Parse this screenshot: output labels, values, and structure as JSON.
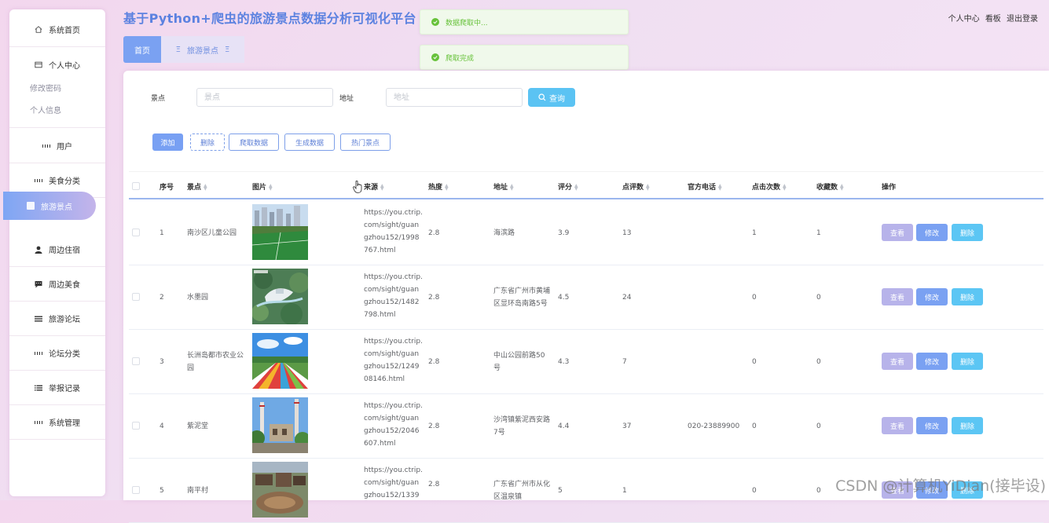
{
  "app": {
    "title": "基于Python+爬虫的旅游景点数据分析可视化平台",
    "top_links": [
      "个人中心",
      "看板",
      "退出登录"
    ]
  },
  "sidebar": {
    "home": "系统首页",
    "personal": "个人中心",
    "personal_sub": [
      "修改密码",
      "个人信息"
    ],
    "items": [
      "用户",
      "美食分类",
      "旅游景点",
      "周边住宿",
      "周边美食",
      "旅游论坛",
      "论坛分类",
      "举报记录",
      "系统管理"
    ],
    "active_index": 2
  },
  "tabs": {
    "home": "首页",
    "scenic": "旅游景点"
  },
  "toasts": [
    "数据爬取中...",
    "爬取完成"
  ],
  "search": {
    "scenic_label": "景点",
    "scenic_placeholder": "景点",
    "address_label": "地址",
    "address_placeholder": "地址",
    "query_label": "查询"
  },
  "actions": {
    "add": "添加",
    "delete": "删除",
    "crawl": "爬取数据",
    "generate": "生成数据",
    "hot": "热门景点"
  },
  "table": {
    "columns": [
      "序号",
      "景点",
      "图片",
      "来源",
      "热度",
      "地址",
      "评分",
      "点评数",
      "官方电话",
      "点击次数",
      "收藏数",
      "操作"
    ],
    "row_actions": {
      "view": "查看",
      "edit": "修改",
      "delete": "删除"
    },
    "rows": [
      {
        "index": "1",
        "name": "南沙区儿童公园",
        "source": [
          "https://you.ctrip.",
          "com/sight/guan",
          "gzhou152/1998",
          "767.html"
        ],
        "heat": "2.8",
        "address": [
          "海滨路"
        ],
        "score": "3.9",
        "reviews": "13",
        "phone": "",
        "clicks": "1",
        "favorites": "1"
      },
      {
        "index": "2",
        "name": "水墨园",
        "source": [
          "https://you.ctrip.",
          "com/sight/guan",
          "gzhou152/1482",
          "798.html"
        ],
        "heat": "2.8",
        "address": [
          "广东省广州市黄埔",
          "区显环岛南路5号"
        ],
        "score": "4.5",
        "reviews": "24",
        "phone": "",
        "clicks": "0",
        "favorites": "0"
      },
      {
        "index": "3",
        "name": [
          "长洲岛都市农业公",
          "园"
        ],
        "source": [
          "https://you.ctrip.",
          "com/sight/guan",
          "gzhou152/1249",
          "08146.html"
        ],
        "heat": "2.8",
        "address": [
          "中山公园前路50",
          "号"
        ],
        "score": "4.3",
        "reviews": "7",
        "phone": "",
        "clicks": "0",
        "favorites": "0"
      },
      {
        "index": "4",
        "name": "紫泥堂",
        "source": [
          "https://you.ctrip.",
          "com/sight/guan",
          "gzhou152/2046",
          "607.html"
        ],
        "heat": "2.8",
        "address": [
          "沙湾镇紫泥西安路",
          "7号"
        ],
        "score": "4.4",
        "reviews": "37",
        "phone": "020-23889900",
        "clicks": "0",
        "favorites": "0"
      },
      {
        "index": "5",
        "name": "南平村",
        "source": [
          "https://you.ctrip.",
          "com/sight/guan",
          "gzhou152/1339"
        ],
        "heat": "2.8",
        "address": [
          "广东省广州市从化",
          "区温泉镇"
        ],
        "score": "5",
        "reviews": "1",
        "phone": "",
        "clicks": "0",
        "favorites": "0"
      }
    ]
  },
  "watermark": "CSDN @计算机YiDian(接毕设)"
}
